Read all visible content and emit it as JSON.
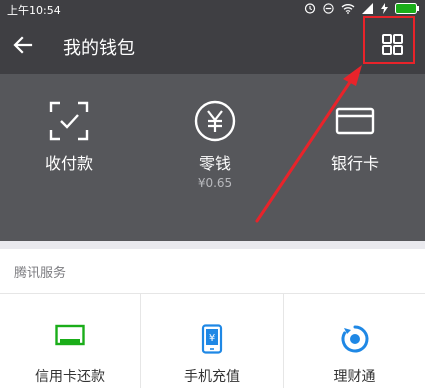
{
  "status_bar": {
    "time": "上午10:54"
  },
  "nav": {
    "title": "我的钱包"
  },
  "top_items": [
    {
      "label": "收付款",
      "sub": ""
    },
    {
      "label": "零钱",
      "sub": "¥0.65"
    },
    {
      "label": "银行卡",
      "sub": ""
    }
  ],
  "services": {
    "title": "腾讯服务",
    "items": [
      {
        "label": "信用卡还款"
      },
      {
        "label": "手机充值"
      },
      {
        "label": "理财通"
      }
    ]
  },
  "colors": {
    "header_bg": "#3f3f43",
    "panel_bg": "#56575b",
    "highlight_red": "#e8232a",
    "service_green": "#1aad19",
    "service_blue": "#1f88e5"
  }
}
